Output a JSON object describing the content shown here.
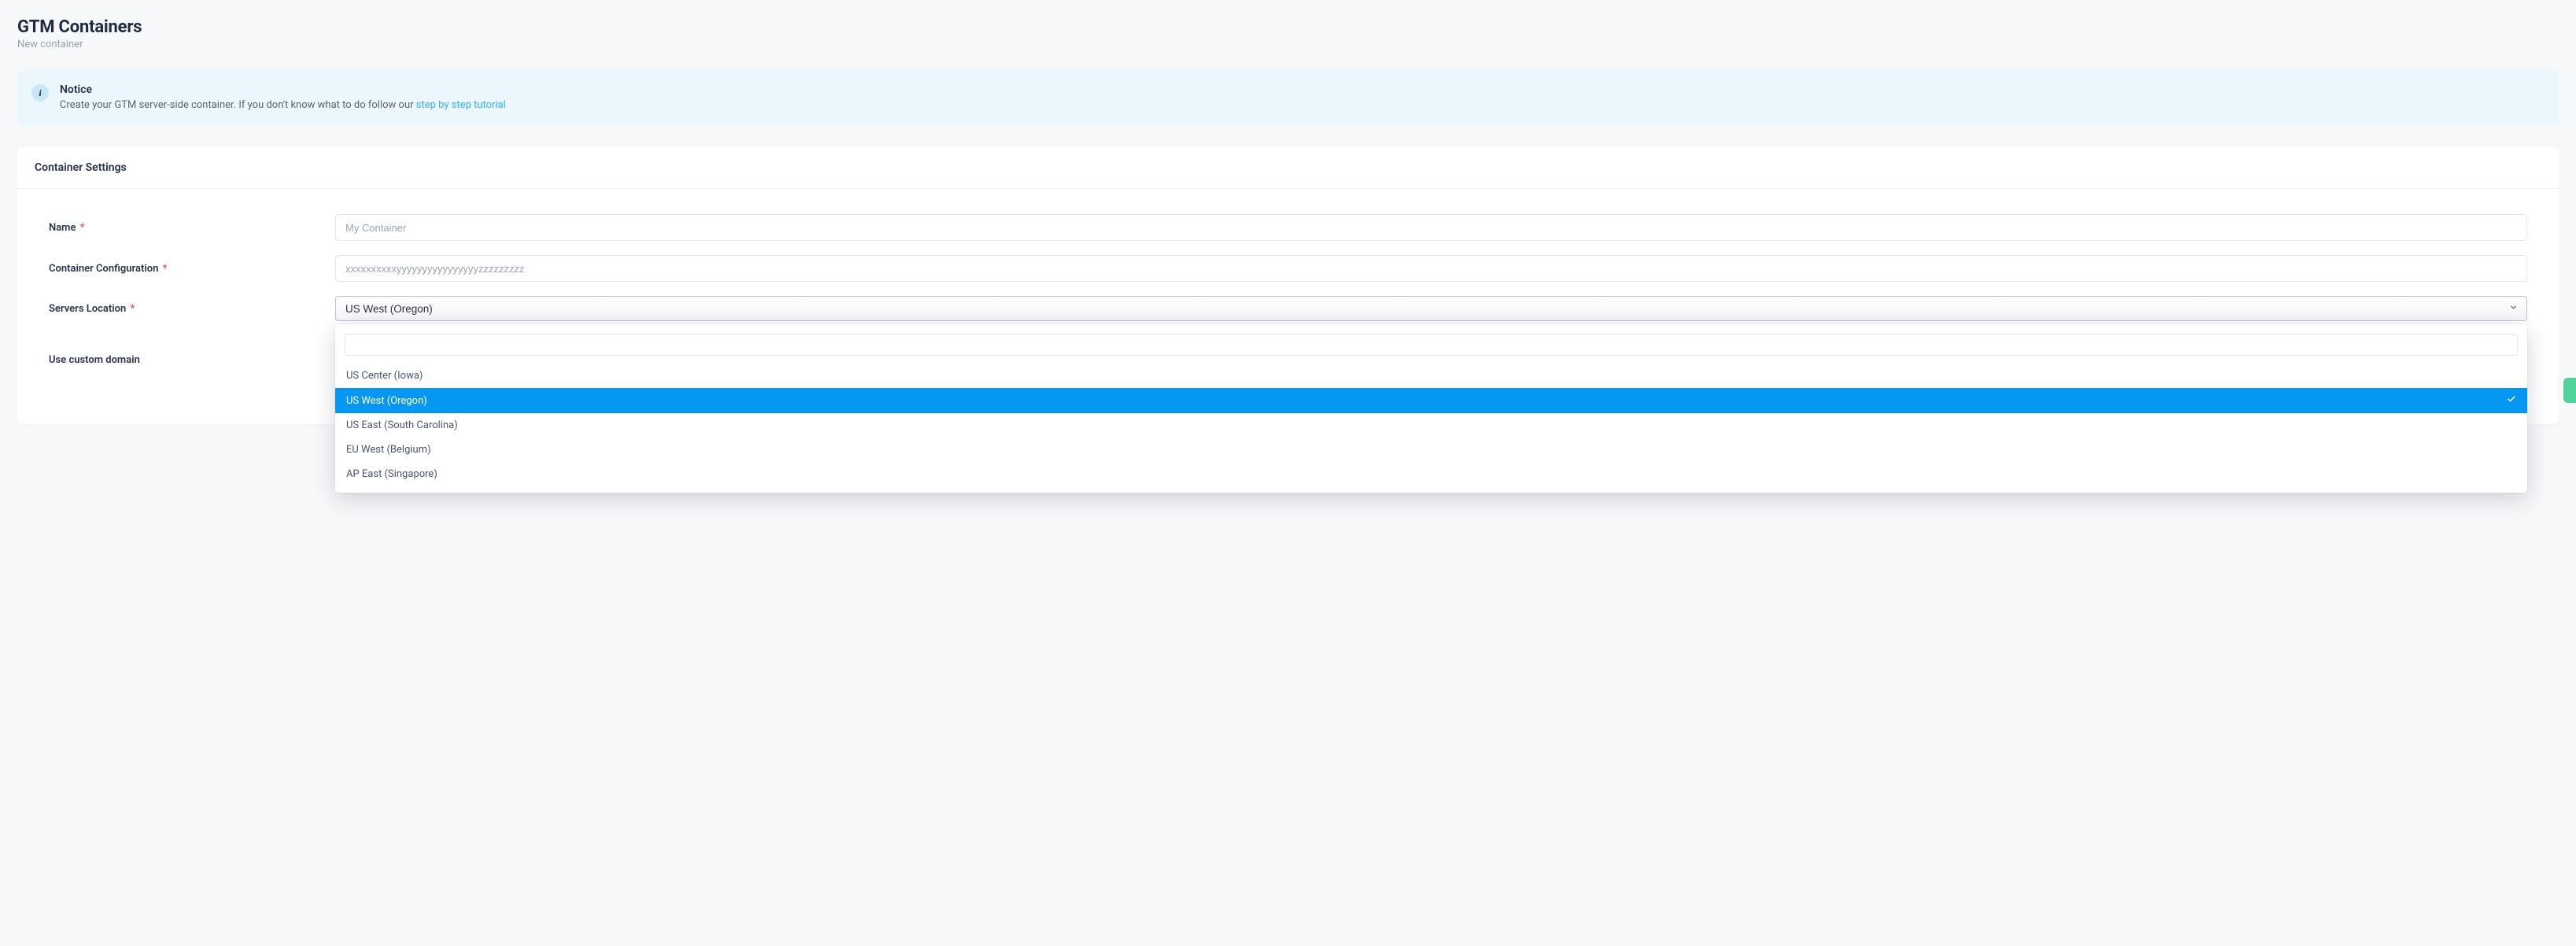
{
  "header": {
    "title": "GTM Containers",
    "subtitle": "New container"
  },
  "notice": {
    "title": "Notice",
    "body_prefix": "Create your GTM server-side container. If you don't know what to do follow our ",
    "link_text": "step by step tutorial"
  },
  "panel": {
    "title": "Container Settings"
  },
  "form": {
    "name": {
      "label": "Name",
      "placeholder": "My Container",
      "value": ""
    },
    "container_config": {
      "label": "Container Configuration",
      "placeholder": "xxxxxxxxxxyyyyyyyyyyyyyyyyzzzzzzzzz",
      "value": ""
    },
    "servers_location": {
      "label": "Servers Location",
      "selected": "US West (Oregon)",
      "options": [
        {
          "label": "US Center (Iowa)",
          "selected": false
        },
        {
          "label": "US West (Oregon)",
          "selected": true
        },
        {
          "label": "US East (South Carolina)",
          "selected": false
        },
        {
          "label": "EU West (Belgium)",
          "selected": false
        },
        {
          "label": "AP East (Singapore)",
          "selected": false
        }
      ]
    },
    "custom_domain": {
      "label": "Use custom domain"
    }
  },
  "marks": {
    "required": "*",
    "info_glyph": "i"
  }
}
